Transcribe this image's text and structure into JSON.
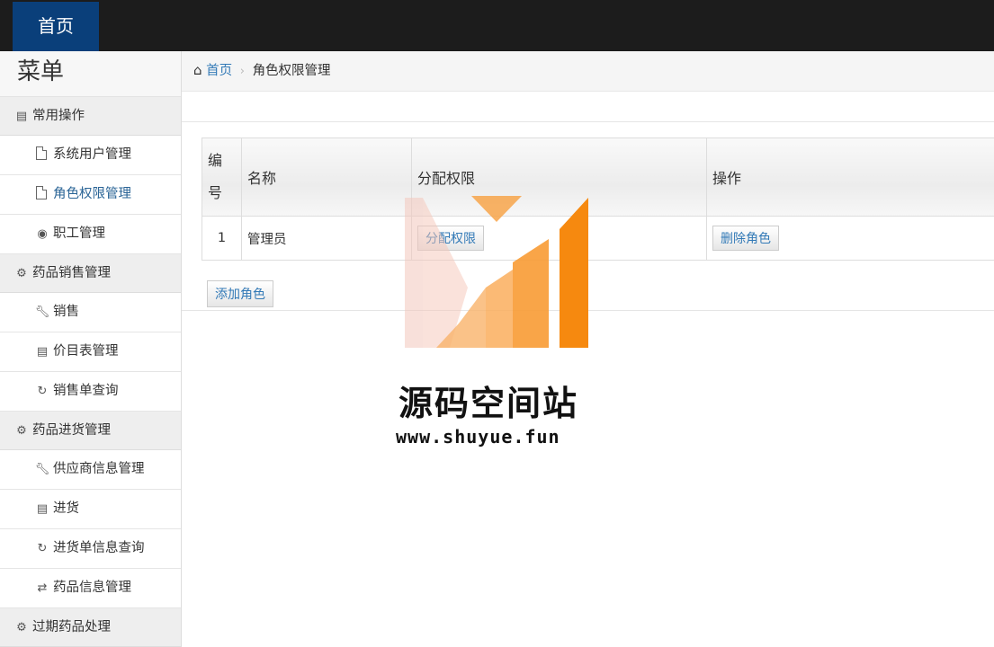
{
  "topnav": {
    "home": "首页"
  },
  "sidebar": {
    "title": "菜单",
    "sections": [
      {
        "label": "常用操作",
        "icon": "book-icon",
        "items": [
          {
            "label": "系统用户管理",
            "icon": "file-icon"
          },
          {
            "label": "角色权限管理",
            "icon": "file-icon",
            "active": true
          },
          {
            "label": "职工管理",
            "icon": "comment-icon"
          }
        ]
      },
      {
        "label": "药品销售管理",
        "icon": "gear-icon",
        "items": [
          {
            "label": "销售",
            "icon": "wrench-icon"
          },
          {
            "label": "价目表管理",
            "icon": "trash-icon"
          },
          {
            "label": "销售单查询",
            "icon": "refresh-icon"
          }
        ]
      },
      {
        "label": "药品进货管理",
        "icon": "gear-icon",
        "items": [
          {
            "label": "供应商信息管理",
            "icon": "wrench-icon"
          },
          {
            "label": "进货",
            "icon": "trash-icon"
          },
          {
            "label": "进货单信息查询",
            "icon": "refresh-icon"
          },
          {
            "label": "药品信息管理",
            "icon": "sync-icon"
          }
        ]
      },
      {
        "label": "过期药品处理",
        "icon": "gear-icon",
        "items": []
      }
    ]
  },
  "breadcrumb": {
    "home": "首页",
    "current": "角色权限管理"
  },
  "table": {
    "headers": [
      "编号",
      "名称",
      "分配权限",
      "操作"
    ],
    "rows": [
      {
        "id": "1",
        "name": "管理员",
        "assign_btn": "分配权限",
        "delete_btn": "删除角色"
      }
    ]
  },
  "add_button": "添加角色",
  "watermark": {
    "title": "源码空间站",
    "url": "www.shuyue.fun"
  }
}
